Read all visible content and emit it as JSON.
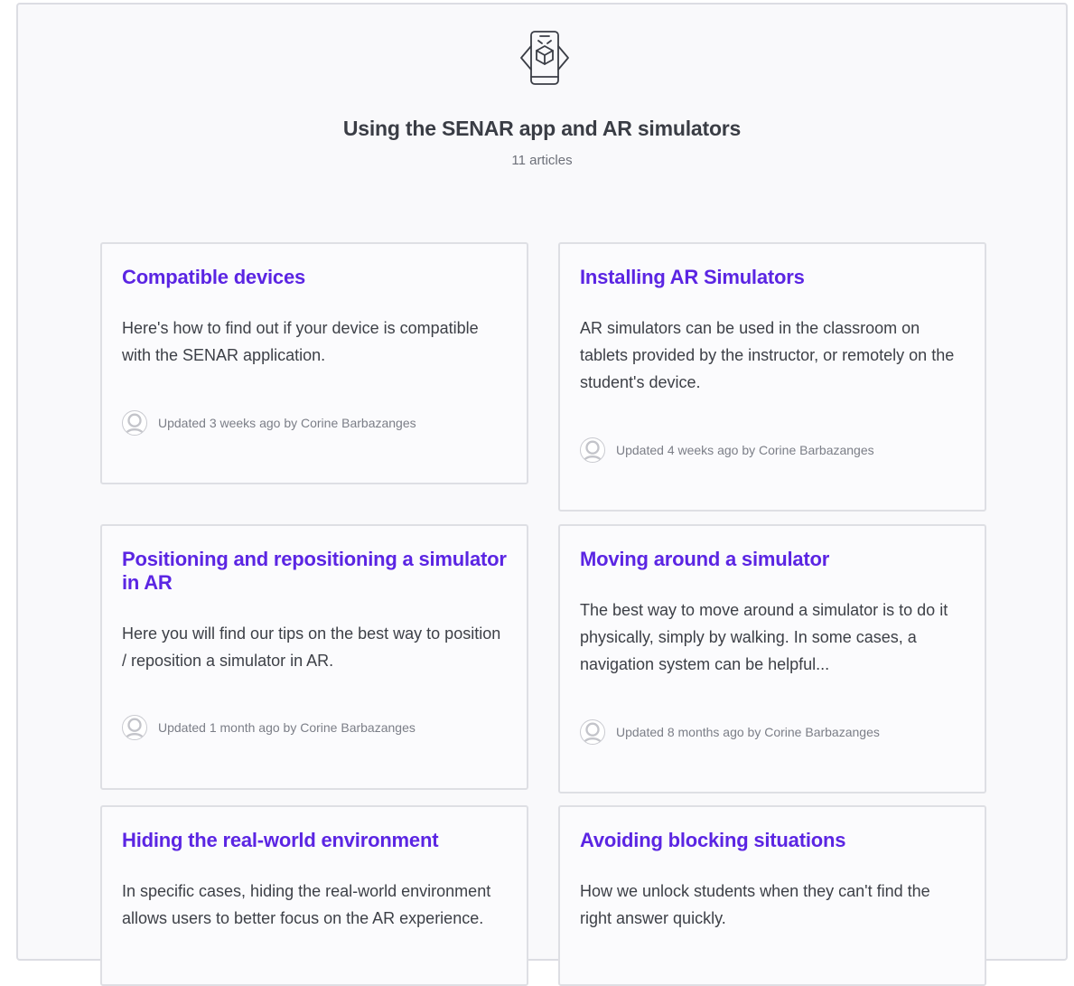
{
  "category": {
    "icon": "ar-phone-cube-icon",
    "title": "Using the SENAR app and AR simulators",
    "count": "11 articles"
  },
  "articles": [
    {
      "title": "Compatible devices",
      "description": "Here's how to find out if your device is compatible with the SENAR application.",
      "meta": "Updated 3 weeks ago by Corine Barbazanges"
    },
    {
      "title": "Installing AR Simulators",
      "description": "AR simulators can be used in the classroom on tablets provided by the instructor, or remotely on the student's device.",
      "meta": "Updated 4 weeks ago by Corine Barbazanges"
    },
    {
      "title": "Positioning and repositioning a simulator in AR",
      "description": "Here you will find our tips on the best way to position / reposition a simulator in AR.",
      "meta": "Updated 1 month ago by Corine Barbazanges"
    },
    {
      "title": "Moving around a simulator",
      "description": "The best way to move around a simulator is to do it physically, simply by walking. In some cases, a navigation system can be helpful...",
      "meta": "Updated 8 months ago by Corine Barbazanges"
    },
    {
      "title": "Hiding the real-world environment",
      "description": "In specific cases, hiding the real-world environment allows users to better focus on the AR experience.",
      "meta": ""
    },
    {
      "title": "Avoiding blocking situations",
      "description": "How we unlock students when they can't find the right answer quickly.",
      "meta": ""
    }
  ],
  "colors": {
    "accent": "#5b25e3",
    "text": "#3d4047",
    "muted": "#7b7e87"
  }
}
